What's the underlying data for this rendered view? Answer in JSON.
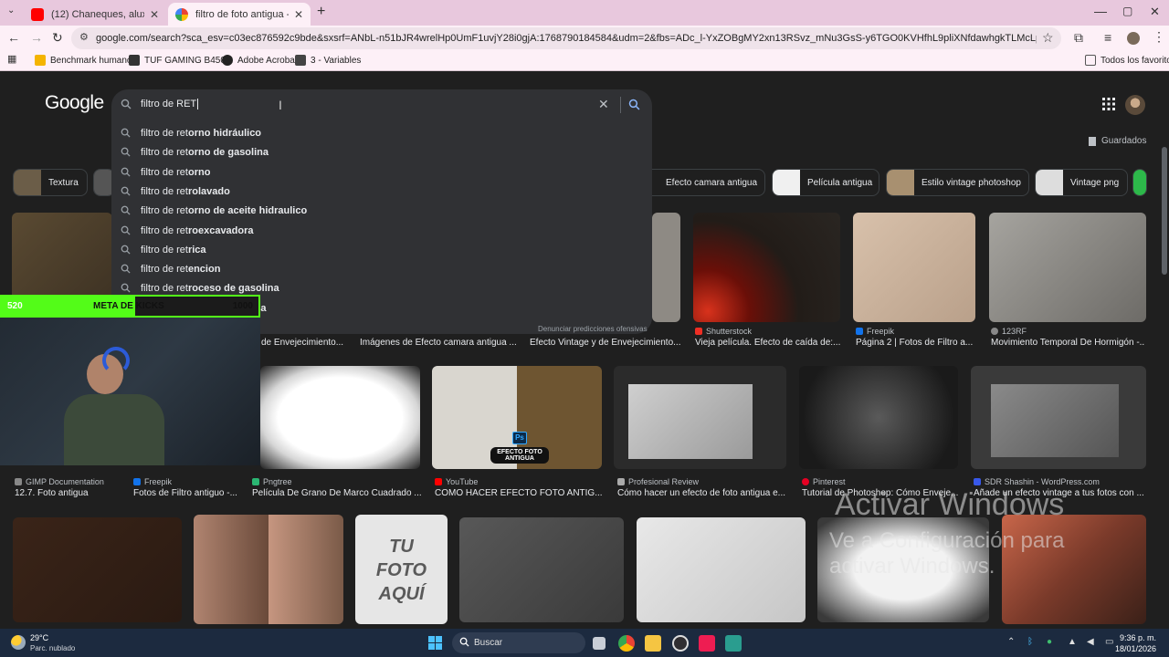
{
  "browser": {
    "tabs": [
      {
        "title": "(12) Chaneques, aluxes e incub",
        "active": false
      },
      {
        "title": "filtro de foto antigua - Buscar c",
        "active": true
      }
    ],
    "new_tab": "+",
    "url": "google.com/search?sca_esv=c03ec876592c9bde&sxsrf=ANbL-n51bJR4wrelHp0UmF1uvjY28i0gjA:1768790184584&udm=2&fbs=ADc_l-YxZOBgMY2xn13RSvz_mNu3GsS-y6TGO0KVHfhL9pliXNfdawhgkTLMcLphGhrPWmJI0MVqoGxDyQ4hybE8Ff4ubv...",
    "bookmarks": [
      "Benchmark humano...",
      "TUF GAMING B450...",
      "Adobe Acrobat",
      "3 - Variables"
    ],
    "all_bookmarks": "Todos los favoritos"
  },
  "google": {
    "logo": "Google",
    "query": "filtro de RET",
    "suggestions": [
      {
        "prefix": "filtro de ret",
        "completion": "orno hidráulico"
      },
      {
        "prefix": "filtro de ret",
        "completion": "orno de gasolina"
      },
      {
        "prefix": "filtro de ret",
        "completion": "orno"
      },
      {
        "prefix": "filtro de ret",
        "completion": "rolavado"
      },
      {
        "prefix": "filtro de ret",
        "completion": "orno de aceite hidraulico"
      },
      {
        "prefix": "filtro de ret",
        "completion": "roexcavadora"
      },
      {
        "prefix": "filtro de ret",
        "completion": "rica"
      },
      {
        "prefix": "filtro de ret",
        "completion": "encion"
      },
      {
        "prefix": "filtro de ret",
        "completion": "roceso de gasolina"
      },
      {
        "prefix": "filtro de ret",
        "completion": "orno simbologia"
      }
    ],
    "report_link": "Denunciar predicciones ofensivas",
    "saved": "Guardados",
    "chips": [
      "Textura",
      "Efecto camara antigua",
      "Película antigua",
      "Estilo vintage photoshop",
      "Vintage png"
    ]
  },
  "results": {
    "row1": [
      {
        "source": "",
        "caption": "de Envejecimiento..."
      },
      {
        "source": "",
        "caption": "Imágenes de Efecto camara antigua ..."
      },
      {
        "source": "",
        "caption": "Efecto Vintage y de Envejecimiento..."
      },
      {
        "source": "Shutterstock",
        "caption": "Vieja película. Efecto de caída de:..."
      },
      {
        "source": "Freepik",
        "caption": "Página 2 | Fotos de Filtro a..."
      },
      {
        "source": "123RF",
        "caption": "Movimiento Temporal De Hormigón -..."
      }
    ],
    "row2": [
      {
        "source": "GIMP Documentation",
        "caption": "12.7. Foto antigua"
      },
      {
        "source": "Freepik",
        "caption": "Fotos de Filtro antiguo -..."
      },
      {
        "source": "Pngtree",
        "caption": "Película De Grano De Marco Cuadrado ..."
      },
      {
        "source": "YouTube",
        "caption": "COMO HACER EFECTO FOTO ANTIG..."
      },
      {
        "source": "Profesional Review",
        "caption": "Cómo hacer un efecto de foto antigua e..."
      },
      {
        "source": "Pinterest",
        "caption": "Tutorial de Photoshop: Cómo Enveje..."
      },
      {
        "source": "SDR Shashin - WordPress.com",
        "caption": "Añade un efecto vintage a tus fotos con ..."
      }
    ],
    "youtube_thumb_text": "EFECTO FOTO ANTIGUA",
    "ps_badge": "Ps",
    "tu_foto_text": "TU FOTO AQUÍ"
  },
  "watermark": {
    "line1": "Activar Windows",
    "line2": "Ve a Configuración para",
    "line3": "activar Windows."
  },
  "overlay": {
    "current": "520",
    "label": "META DE KICKS",
    "goal": "1000",
    "progress": 0.52,
    "accent": "#53fc18"
  },
  "taskbar": {
    "temp": "29°C",
    "weather": "Parc. nublado",
    "search": "Buscar",
    "time": "9:36 p. m.",
    "date": "18/01/2026"
  }
}
